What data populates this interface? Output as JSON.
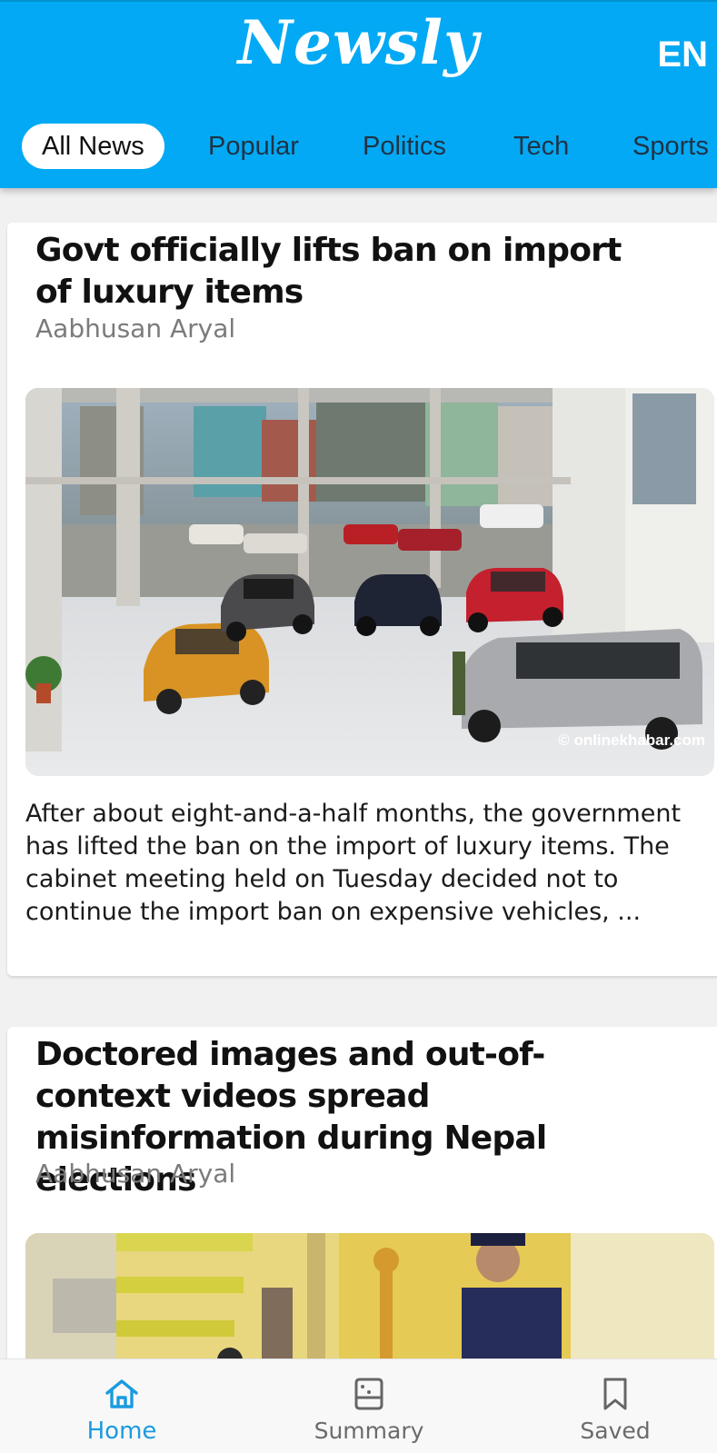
{
  "app": {
    "title": "Newsly",
    "language": "EN"
  },
  "tabs": [
    {
      "label": "All News",
      "active": true
    },
    {
      "label": "Popular",
      "active": false
    },
    {
      "label": "Politics",
      "active": false
    },
    {
      "label": "Tech",
      "active": false
    },
    {
      "label": "Sports",
      "active": false
    }
  ],
  "articles": [
    {
      "title": "Govt officially lifts ban on import of luxury items",
      "author": "Aabhusan Aryal",
      "image_watermark": "© onlinekhabar.com",
      "excerpt": "After about eight-and-a-half months, the government has lifted the ban on the import of luxury items. The cabinet meeting held on Tuesday decided not to continue the import ban on expensive vehicles, ..."
    },
    {
      "title": "Doctored images and out-of-context videos spread misinformation during Nepal elections",
      "author": "Aabhusan Aryal"
    }
  ],
  "bottom_nav": [
    {
      "label": "Home",
      "icon": "home-icon",
      "active": true
    },
    {
      "label": "Summary",
      "icon": "summary-icon",
      "active": false
    },
    {
      "label": "Saved",
      "icon": "bookmark-icon",
      "active": false
    }
  ],
  "colors": {
    "primary": "#03a9f4",
    "active_nav": "#1a9be0",
    "background": "#f1f1f1"
  }
}
